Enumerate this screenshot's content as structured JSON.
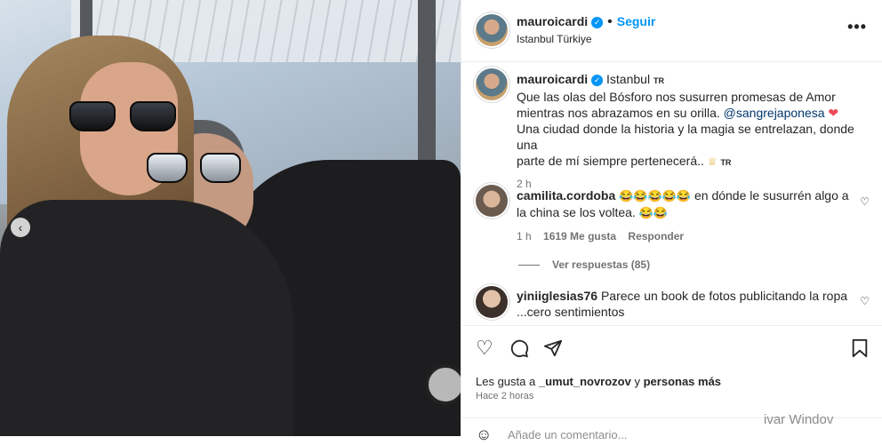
{
  "header": {
    "username": "mauroicardi",
    "follow_label": "Seguir",
    "location": "Istanbul Türkiye"
  },
  "caption": {
    "username": "mauroicardi",
    "location_tag": "Istanbul",
    "location_flag": "TR",
    "line1": "Que las olas del Bósforo nos susurren promesas de Amor",
    "line2a": "mientras nos abrazamos en su orilla.",
    "mention": "@sangrejaponesa",
    "line3": "Una ciudad donde la historia y la magia se entrelazan, donde una",
    "line4": "parte de mí siempre pertenecerá..",
    "end_flag": "TR",
    "time": "2 h"
  },
  "comments": [
    {
      "username": "camilita.cordoba",
      "text_a": "en dónde le susurrén algo a",
      "text_b": "la china se los voltea.",
      "time": "1 h",
      "likes": "1619 Me gusta",
      "reply": "Responder",
      "view_replies": "Ver respuestas (85)"
    },
    {
      "username": "yiniiglesias76",
      "text_a": "Parece un book de fotos publicitando la ropa",
      "text_b": "...cero sentimientos"
    }
  ],
  "likes_line": {
    "prefix": "Les gusta a",
    "user": "_umut_novrozov",
    "middle": "y",
    "rest": "personas más"
  },
  "posted_ago": "Hace 2 horas",
  "add_comment_placeholder": "Añade un comentario...",
  "watermark": "ivar Windov",
  "icons": [
    "verified-icon",
    "more-options-icon",
    "heart-icon",
    "comment-icon",
    "share-icon",
    "bookmark-icon",
    "emoji-icon",
    "chevron-left-icon"
  ],
  "colors": {
    "accent": "#0095f6",
    "heart": "#ed4956",
    "muted": "#737373"
  }
}
